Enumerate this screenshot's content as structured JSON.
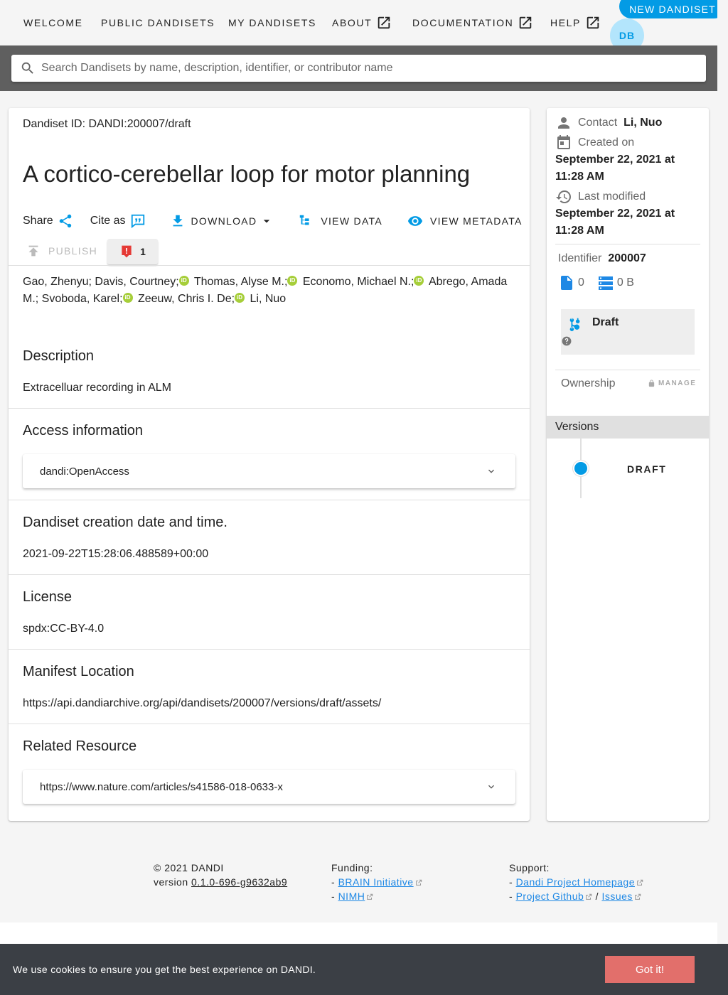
{
  "nav": {
    "welcome": "WELCOME",
    "public": "PUBLIC DANDISETS",
    "my": "MY DANDISETS",
    "about": "ABOUT",
    "documentation": "DOCUMENTATION",
    "help": "HELP",
    "new_dandiset": "NEW DANDISET",
    "avatar_initials": "DB"
  },
  "search": {
    "placeholder": "Search Dandisets by name, description, identifier, or contributor name"
  },
  "dandiset": {
    "id_label": "Dandiset ID: DANDI:200007/draft",
    "title": "A cortico-cerebellar loop for motor planning",
    "actions": {
      "share": "Share",
      "cite": "Cite as",
      "download": "DOWNLOAD",
      "view_data": "VIEW DATA",
      "view_metadata": "VIEW METADATA",
      "publish": "PUBLISH",
      "error_count": "1"
    },
    "authors": [
      "Gao, Zhenyu;",
      "Davis, Courtney;",
      "Thomas, Alyse M.;",
      "Economo, Michael N.;",
      "Abrego, Amada M.;",
      "Svoboda, Karel;",
      "Zeeuw, Chris I. De;",
      "Li, Nuo"
    ],
    "orcid_glyph": "iD",
    "sections": {
      "description_head": "Description",
      "description_text": "Extracelluar recording in ALM",
      "access_head": "Access information",
      "access_value": "dandi:OpenAccess",
      "created_head": "Dandiset creation date and time.",
      "created_value": "2021-09-22T15:28:06.488589+00:00",
      "license_head": "License",
      "license_value": "spdx:CC-BY-4.0",
      "manifest_head": "Manifest Location",
      "manifest_value": "https://api.dandiarchive.org/api/dandisets/200007/versions/draft/assets/",
      "related_head": "Related Resource",
      "related_value": "https://www.nature.com/articles/s41586-018-0633-x"
    }
  },
  "side": {
    "contact_label": "Contact",
    "contact_value": "Li, Nuo",
    "created_label": "Created on",
    "created_value_1": "September 22, 2021 at",
    "created_value_2": "11:28 AM",
    "modified_label": "Last modified",
    "modified_value_1": "September 22, 2021 at",
    "modified_value_2": "11:28 AM",
    "identifier_label": "Identifier",
    "identifier_value": "200007",
    "files_count": "0",
    "size": "0 B",
    "draft_label": "Draft",
    "ownership_label": "Ownership",
    "manage": "MANAGE",
    "versions_head": "Versions",
    "version_item": "DRAFT"
  },
  "footer": {
    "copyright": "© 2021 DANDI",
    "version_label": "version",
    "version_value": "0.1.0-696-g9632ab9",
    "funding_label": "Funding:",
    "funding_1": "BRAIN Initiative",
    "funding_2": "NIMH",
    "support_label": "Support:",
    "support_1": "Dandi Project Homepage",
    "support_2": "Project Github",
    "support_sep": "/",
    "support_3": "Issues",
    "dash": "-"
  },
  "cookie": {
    "message": "We use cookies to ensure you get the best experience on DANDI.",
    "button": "Got it!"
  },
  "colors": {
    "accent": "#039be5",
    "orcid": "#a6ce39",
    "error": "#e53935",
    "cookie_bg": "#3b3f45",
    "cookie_btn": "#e26f6b"
  }
}
